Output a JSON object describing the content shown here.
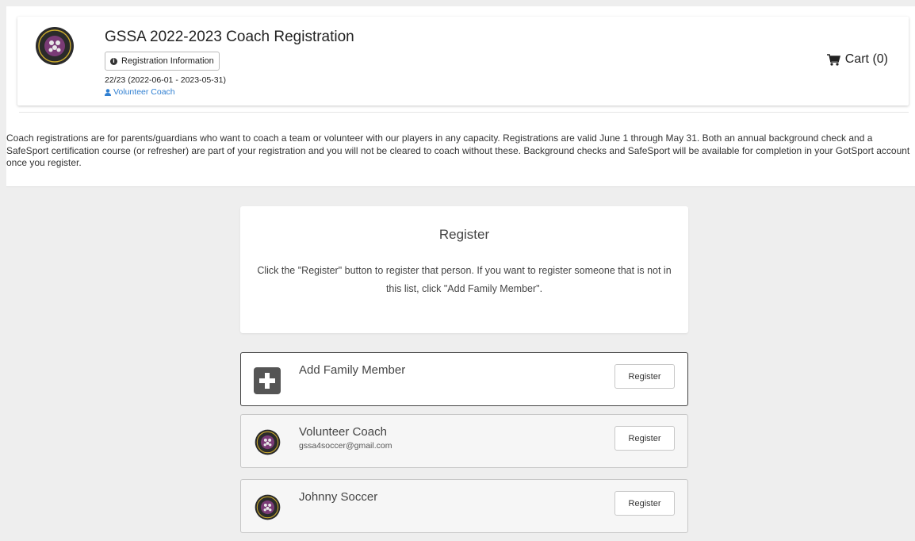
{
  "header": {
    "title": "GSSA 2022-2023 Coach Registration",
    "registration_info_label": "Registration Information",
    "season": "22/23 (2022-06-01 - 2023-05-31)",
    "role_link": "Volunteer Coach",
    "cart_label": "Cart (0)"
  },
  "description": "Coach registrations are for parents/guardians who want to coach a team or volunteer with our players in any capacity. Registrations are valid June 1 through May 31. Both an annual background check and a SafeSport certification course (or refresher) are part of your registration and you will not be cleared to coach without these. Background checks and SafeSport will be available for completion in your GotSport account once you register.",
  "register_section": {
    "title": "Register",
    "instructions": "Click the \"Register\" button to register that person. If you want to register someone that is not in this list, click \"Add Family Member\"."
  },
  "people": [
    {
      "name": "Add Family Member",
      "email": "",
      "button": "Register",
      "icon": "plus-icon"
    },
    {
      "name": "Volunteer Coach",
      "email": "gssa4soccer@gmail.com",
      "button": "Register",
      "icon": "club-logo-icon"
    },
    {
      "name": "Johnny Soccer",
      "email": "",
      "button": "Register",
      "icon": "club-logo-icon"
    }
  ],
  "colors": {
    "link": "#2f7fd1",
    "page_background": "#eeeeee",
    "logo_ring": "#2b2b2b",
    "logo_accent": "#c8a92c"
  },
  "icons": {
    "info": "info-circle-icon",
    "user": "user-icon",
    "cart": "shopping-cart-icon",
    "logo": "club-logo-icon"
  }
}
